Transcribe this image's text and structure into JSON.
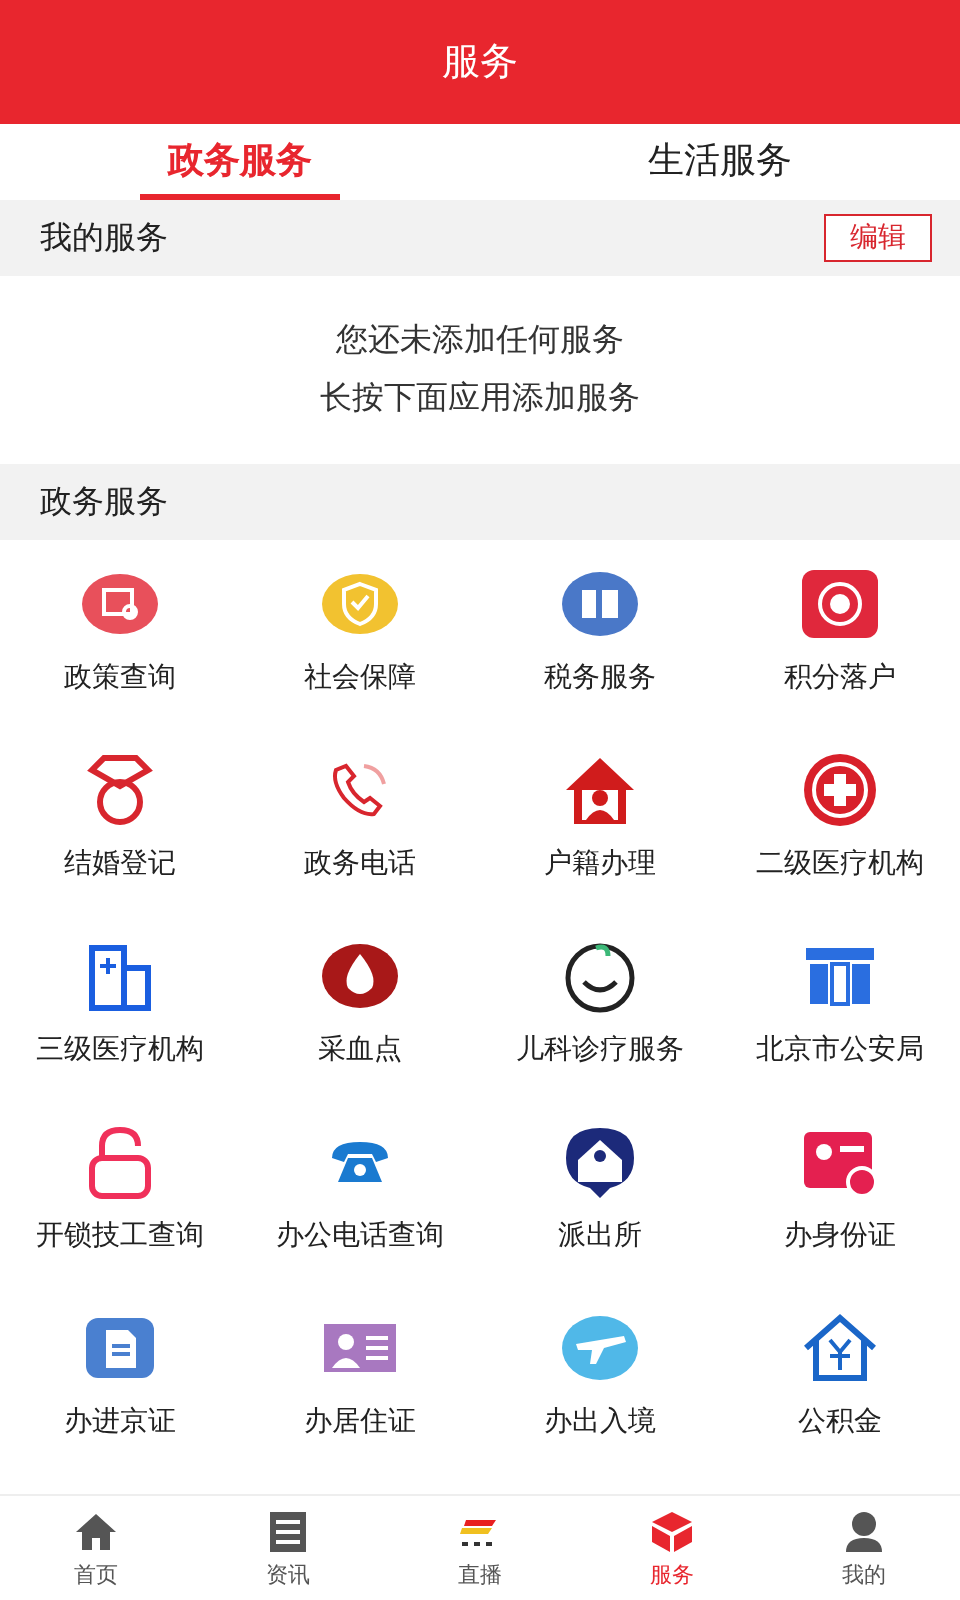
{
  "header": {
    "title": "服务"
  },
  "tabs": [
    {
      "label": "政务服务",
      "selected": true
    },
    {
      "label": "生活服务",
      "selected": false
    }
  ],
  "my_services": {
    "title": "我的服务",
    "edit_button": "编辑",
    "empty_lines": [
      "您还未添加任何服务",
      "长按下面应用添加服务"
    ]
  },
  "section": {
    "title": "政务服务"
  },
  "services": [
    {
      "label": "政策查询",
      "color": "#e8505b"
    },
    {
      "label": "社会保障",
      "color": "#f2c230"
    },
    {
      "label": "税务服务",
      "color": "#4a78c8"
    },
    {
      "label": "积分落户",
      "color": "#e0283c"
    },
    {
      "label": "结婚登记",
      "color": "#d8262e"
    },
    {
      "label": "政务电话",
      "color": "#d8262e"
    },
    {
      "label": "户籍办理",
      "color": "#d01c1c"
    },
    {
      "label": "二级医疗机构",
      "color": "#d8202a"
    },
    {
      "label": "三级医疗机构",
      "color": "#1a5ee0"
    },
    {
      "label": "采血点",
      "color": "#a81818"
    },
    {
      "label": "儿科诊疗服务",
      "color": "#222222"
    },
    {
      "label": "北京市公安局",
      "color": "#2a6ee0"
    },
    {
      "label": "开锁技工查询",
      "color": "#f0305a"
    },
    {
      "label": "办公电话查询",
      "color": "#1a7ad0"
    },
    {
      "label": "派出所",
      "color": "#1c2a7a"
    },
    {
      "label": "办身份证",
      "color": "#e42050"
    },
    {
      "label": "办进京证",
      "color": "#4a80d0"
    },
    {
      "label": "办居住证",
      "color": "#a878c0"
    },
    {
      "label": "办出入境",
      "color": "#50b8e8"
    },
    {
      "label": "公积金",
      "color": "#1a66c8"
    }
  ],
  "bottom_nav": [
    {
      "label": "首页",
      "selected": false
    },
    {
      "label": "资讯",
      "selected": false
    },
    {
      "label": "直播",
      "selected": false
    },
    {
      "label": "服务",
      "selected": true
    },
    {
      "label": "我的",
      "selected": false
    }
  ]
}
